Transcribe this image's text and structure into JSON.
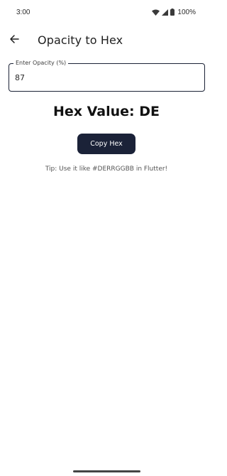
{
  "status_bar": {
    "time": "3:00",
    "battery": "100%",
    "icons": [
      "wifi-icon",
      "cellular-signal-icon",
      "battery-icon"
    ]
  },
  "app_bar": {
    "title": "Opacity to Hex",
    "back_icon": "arrow-left-icon"
  },
  "opacity_field": {
    "label": "Enter Opacity (%)",
    "value": "87"
  },
  "result": {
    "text": "Hex Value: DE"
  },
  "copy_button": {
    "label": "Copy Hex"
  },
  "tip": {
    "text": "Tip: Use it like #DERRGGBB in Flutter!"
  },
  "colors": {
    "primary": "#1b2238",
    "background": "#ffffff",
    "text": "#111111"
  }
}
